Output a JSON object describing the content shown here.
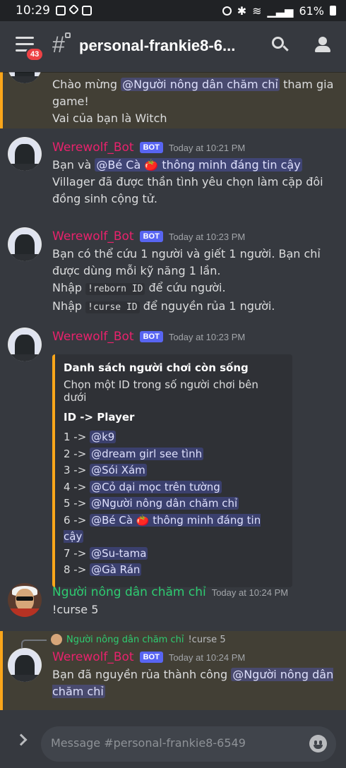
{
  "statusbar": {
    "time": "10:29",
    "battery": "61%"
  },
  "header": {
    "channel": "personal-frankie8-6...",
    "badge": "43"
  },
  "messages": {
    "m0": {
      "line1_pre": "Chào mừng ",
      "line1_mention": "@Người nông dân chăm chỉ",
      "line1_post": " tham gia game!",
      "line2": "Vai của bạn là Witch"
    },
    "m1": {
      "user": "Werewolf_Bot",
      "tag": "BOT",
      "time": "Today at 10:21 PM",
      "pre": "Bạn và ",
      "mention": "@Bé Cà 🍅 thông minh đáng tin cậy",
      "post": " Villager đã được thần tình yêu chọn làm cặp đôi đồng sinh cộng tử."
    },
    "m2": {
      "user": "Werewolf_Bot",
      "tag": "BOT",
      "time": "Today at 10:23 PM",
      "line1": "Bạn có thể cứu 1 người và giết 1 người. Bạn chỉ được dùng mỗi kỹ năng 1 lần.",
      "line2_pre": "Nhập ",
      "line2_code": "!reborn ID",
      "line2_post": " để cứu người.",
      "line3_pre": "Nhập ",
      "line3_code": "!curse ID",
      "line3_post": " để nguyền rủa 1 người."
    },
    "m3": {
      "user": "Werewolf_Bot",
      "tag": "BOT",
      "time": "Today at 10:23 PM",
      "embed": {
        "title": "Danh sách người chơi còn sống",
        "desc": "Chọn một ID trong số người chơi bên dưới",
        "field": "ID -> Player",
        "rows": [
          {
            "id": "1 -> ",
            "player": "@k9"
          },
          {
            "id": "2 -> ",
            "player": "@dream girl see tình"
          },
          {
            "id": "3 -> ",
            "player": "@Sói Xám"
          },
          {
            "id": "4 -> ",
            "player": "@Cỏ dại mọc trên tường"
          },
          {
            "id": "5 -> ",
            "player": "@Người nông dân chăm chỉ"
          },
          {
            "id": "6 -> ",
            "player": "@Bé Cà 🍅 thông minh đáng tin cậy"
          },
          {
            "id": "7 -> ",
            "player": "@Su-tama"
          },
          {
            "id": "8 -> ",
            "player": "@Gà Rán"
          }
        ]
      }
    },
    "m4": {
      "user": "Người nông dân chăm chỉ",
      "time": "Today at 10:24 PM",
      "text": "!curse 5"
    },
    "m5": {
      "reply_user": "Người nông dân chăm chỉ",
      "reply_text": "!curse 5",
      "user": "Werewolf_Bot",
      "tag": "BOT",
      "time": "Today at 10:24 PM",
      "pre": "Bạn đã nguyền rủa thành công ",
      "mention": "@Người nông dân chăm chỉ"
    }
  },
  "composer": {
    "placeholder": "Message #personal-frankie8-6549"
  },
  "colors": {
    "bot_name": "#e9226c",
    "user_name": "#2ecc71",
    "highlight_bar": "#faa61a",
    "bot_tag": "#5865f2"
  }
}
